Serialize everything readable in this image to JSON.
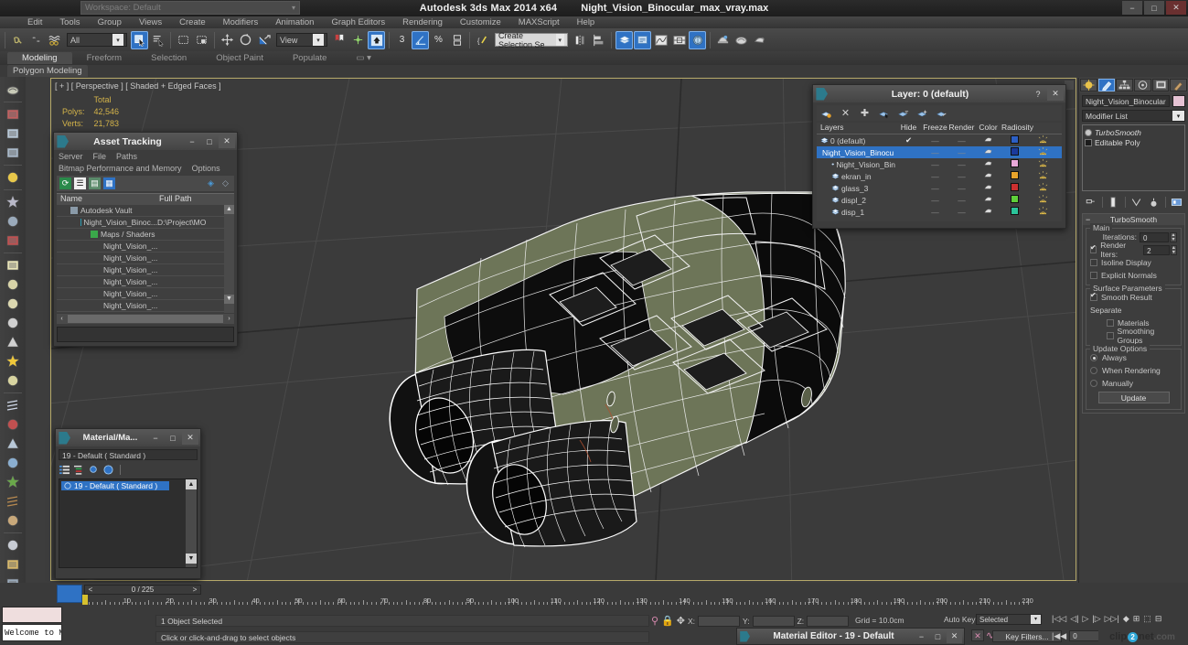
{
  "titlebar": {
    "workspace_value": "Workspace: Default",
    "app_title": "Autodesk 3ds Max  2014 x64",
    "file_title": "Night_Vision_Binocular_max_vray.max",
    "minimize": "−",
    "maximize": "□",
    "close": "✕"
  },
  "menubar": [
    "Edit",
    "Tools",
    "Group",
    "Views",
    "Create",
    "Modifiers",
    "Animation",
    "Graph Editors",
    "Rendering",
    "Customize",
    "MAXScript",
    "Help"
  ],
  "maintoolbar": {
    "selection_filter": "All",
    "reference_coord": "View",
    "named_selection_sets": "Create Selection Se",
    "pct_label": "%",
    "three_label": "3"
  },
  "ribbon": {
    "tabs": [
      "Modeling",
      "Freeform",
      "Selection",
      "Object Paint",
      "Populate"
    ],
    "active_tab": "Modeling",
    "subtab": "Polygon Modeling"
  },
  "viewport": {
    "label": "[ + ] [ Perspective ] [ Shaded + Edged Faces ]",
    "stats_header": "Total",
    "stats": [
      {
        "name": "Polys:",
        "value": "42,546"
      },
      {
        "name": "Verts:",
        "value": "21,783"
      }
    ],
    "body_color": "#6d7558",
    "wire_color": "#f2f2f2",
    "bg_color": "#3b3b3b"
  },
  "asset_tracking": {
    "title": "Asset Tracking",
    "menu1": [
      "Server",
      "File",
      "Paths"
    ],
    "menu2": [
      "Bitmap Performance and Memory",
      "Options"
    ],
    "columns": [
      "Name",
      "Full Path"
    ],
    "rows": [
      {
        "name": "Autodesk Vault",
        "path": "",
        "indent": 1,
        "icon": "vault-icon"
      },
      {
        "name": "Night_Vision_Binoc...",
        "path": "D:\\Project\\MO",
        "indent": 2,
        "icon": "max-file-icon"
      },
      {
        "name": "Maps / Shaders",
        "path": "",
        "indent": 3,
        "icon": "maps-icon"
      },
      {
        "name": "Night_Vision_...",
        "path": "",
        "indent": 4,
        "icon": "bitmap-icon"
      },
      {
        "name": "Night_Vision_...",
        "path": "",
        "indent": 4,
        "icon": "bitmap-icon"
      },
      {
        "name": "Night_Vision_...",
        "path": "",
        "indent": 4,
        "icon": "bitmap-icon"
      },
      {
        "name": "Night_Vision_...",
        "path": "",
        "indent": 4,
        "icon": "bitmap-icon"
      },
      {
        "name": "Night_Vision_...",
        "path": "",
        "indent": 4,
        "icon": "bitmap-icon"
      },
      {
        "name": "Night_Vision_...",
        "path": "",
        "indent": 4,
        "icon": "bitmap-icon"
      }
    ]
  },
  "layer_dialog": {
    "title": "Layer: 0 (default)",
    "help": "?",
    "close": "✕",
    "columns": [
      "Layers",
      "Hide",
      "Freeze",
      "Render",
      "Color",
      "Radiosity"
    ],
    "rows": [
      {
        "name": "0 (default)",
        "current": "✔",
        "hide": "—",
        "freeze": "—",
        "color": "#2c5fc4",
        "selected": false,
        "indent": 0
      },
      {
        "name": "Night_Vision_Binocu",
        "current": "",
        "hide": "—",
        "freeze": "—",
        "color": "#1a3a9c",
        "selected": true,
        "indent": 0
      },
      {
        "name": "Night_Vision_Bin",
        "current": "",
        "hide": "—",
        "freeze": "—",
        "color": "#e8a8d8",
        "selected": false,
        "indent": 1
      },
      {
        "name": "ekran_in",
        "current": "",
        "hide": "—",
        "freeze": "—",
        "color": "#e8a32b",
        "selected": false,
        "indent": 1
      },
      {
        "name": "glass_3",
        "current": "",
        "hide": "—",
        "freeze": "—",
        "color": "#cc3030",
        "selected": false,
        "indent": 1
      },
      {
        "name": "displ_2",
        "current": "",
        "hide": "—",
        "freeze": "—",
        "color": "#5fcf3a",
        "selected": false,
        "indent": 1
      },
      {
        "name": "disp_1",
        "current": "",
        "hide": "—",
        "freeze": "—",
        "color": "#2bc49a",
        "selected": false,
        "indent": 1
      }
    ]
  },
  "material_browser": {
    "title": "Material/Ma...",
    "field_value": "19 - Default  ( Standard )",
    "list_item": "19 - Default  ( Standard )"
  },
  "command_panel": {
    "object_name": "Night_Vision_Binocular",
    "object_color": "#e6c3d4",
    "modifier_list": "Modifier List",
    "stack": [
      {
        "label": "TurboSmooth",
        "italic": true
      },
      {
        "label": "Editable Poly",
        "italic": false
      }
    ],
    "rollup_title": "TurboSmooth",
    "main_group": "Main",
    "iterations_label": "Iterations:",
    "iterations_value": "0",
    "render_iters_label": "Render Iters:",
    "render_iters_value": "2",
    "render_iters_checked": true,
    "isoline_display": "Isoline Display",
    "explicit_normals": "Explicit Normals",
    "surface_params_group": "Surface Parameters",
    "smooth_result": "Smooth Result",
    "smooth_result_checked": true,
    "separate_label": "Separate",
    "materials": "Materials",
    "smoothing_groups": "Smoothing Groups",
    "update_group": "Update Options",
    "update_options": [
      "Always",
      "When Rendering",
      "Manually"
    ],
    "update_selected": "Always",
    "update_button": "Update"
  },
  "timeline": {
    "frame_readout": "0 / 225",
    "prev_arrow": "<",
    "next_arrow": ">",
    "ticks": [
      0,
      10,
      20,
      30,
      40,
      50,
      60,
      70,
      80,
      90,
      100,
      110,
      120,
      130,
      140,
      150,
      160,
      170,
      180,
      190,
      200,
      210,
      220
    ]
  },
  "statusbar": {
    "mini_listener_text": "Welcome to M",
    "objects_selected": "1 Object Selected",
    "prompt": "Click or click-and-drag to select objects",
    "x_label": "X:",
    "x_value": "",
    "y_label": "Y:",
    "y_value": "",
    "z_label": "Z:",
    "z_value": "",
    "grid_label": "Grid = 10.0cm",
    "auto_key": "Auto Key",
    "selection_level": "Selected",
    "key_filters": "Key Filters...",
    "current_frame": "0",
    "watermark": "clip2net.com"
  },
  "material_editor_bar": {
    "title": "Material Editor - 19 - Default",
    "minimize": "−",
    "maximize": "□",
    "close": "✕"
  }
}
